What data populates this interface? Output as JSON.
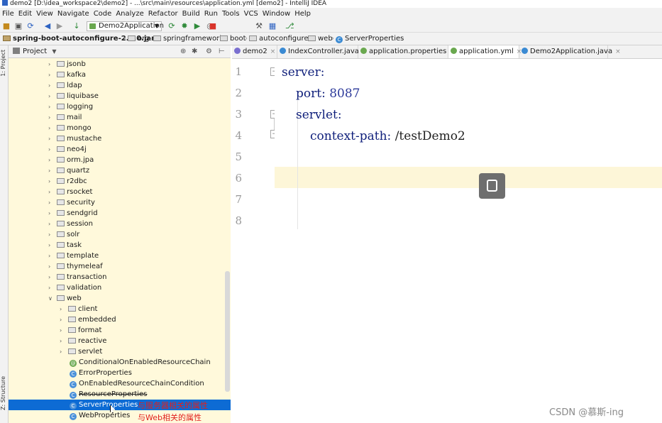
{
  "window": {
    "title": "demo2 [D:\\idea_workspace2\\demo2] - ...\\src\\main\\resources\\application.yml [demo2] - IntelliJ IDEA"
  },
  "menu": [
    {
      "label": "File"
    },
    {
      "label": "Edit"
    },
    {
      "label": "View"
    },
    {
      "label": "Navigate"
    },
    {
      "label": "Code"
    },
    {
      "label": "Analyze"
    },
    {
      "label": "Refactor"
    },
    {
      "label": "Build"
    },
    {
      "label": "Run"
    },
    {
      "label": "Tools"
    },
    {
      "label": "VCS"
    },
    {
      "label": "Window"
    },
    {
      "label": "Help"
    }
  ],
  "toolbar": {
    "run_config": "Demo2Application",
    "icons": [
      "open-icon",
      "save-icon",
      "sync-icon",
      "back-icon",
      "forward-icon",
      "build-icon",
      "run-icon",
      "debug-icon",
      "coverage-icon",
      "profile-icon",
      "stop-icon",
      "wrench-icon",
      "structure-icon",
      "vcs-icon"
    ]
  },
  "breadcrumb": [
    {
      "label": "spring-boot-autoconfigure-2.4.0.jar",
      "icon": "jar-icon"
    },
    {
      "label": "org",
      "icon": "folder-icon"
    },
    {
      "label": "springframework",
      "icon": "folder-icon"
    },
    {
      "label": "boot",
      "icon": "folder-icon"
    },
    {
      "label": "autoconfigure",
      "icon": "folder-icon"
    },
    {
      "label": "web",
      "icon": "folder-icon"
    },
    {
      "label": "ServerProperties",
      "icon": "class-icon"
    }
  ],
  "side_tabs": {
    "project": "1: Project",
    "structure": "Z: Structure"
  },
  "project_panel": {
    "title": "Project",
    "tree": [
      {
        "label": "jsonb",
        "type": "folder"
      },
      {
        "label": "kafka",
        "type": "folder"
      },
      {
        "label": "ldap",
        "type": "folder"
      },
      {
        "label": "liquibase",
        "type": "folder"
      },
      {
        "label": "logging",
        "type": "folder"
      },
      {
        "label": "mail",
        "type": "folder"
      },
      {
        "label": "mongo",
        "type": "folder"
      },
      {
        "label": "mustache",
        "type": "folder"
      },
      {
        "label": "neo4j",
        "type": "folder"
      },
      {
        "label": "orm.jpa",
        "type": "folder"
      },
      {
        "label": "quartz",
        "type": "folder"
      },
      {
        "label": "r2dbc",
        "type": "folder"
      },
      {
        "label": "rsocket",
        "type": "folder"
      },
      {
        "label": "security",
        "type": "folder"
      },
      {
        "label": "sendgrid",
        "type": "folder"
      },
      {
        "label": "session",
        "type": "folder"
      },
      {
        "label": "solr",
        "type": "folder"
      },
      {
        "label": "task",
        "type": "folder"
      },
      {
        "label": "template",
        "type": "folder"
      },
      {
        "label": "thymeleaf",
        "type": "folder"
      },
      {
        "label": "transaction",
        "type": "folder"
      },
      {
        "label": "validation",
        "type": "folder"
      },
      {
        "label": "web",
        "type": "folder",
        "expanded": true
      },
      {
        "label": "client",
        "type": "folder"
      },
      {
        "label": "embedded",
        "type": "folder"
      },
      {
        "label": "format",
        "type": "folder"
      },
      {
        "label": "reactive",
        "type": "folder"
      },
      {
        "label": "servlet",
        "type": "folder"
      },
      {
        "label": "ConditionalOnEnabledResourceChain",
        "type": "annotation"
      },
      {
        "label": "ErrorProperties",
        "type": "class"
      },
      {
        "label": "OnEnabledResourceChainCondition",
        "type": "class"
      },
      {
        "label": "ResourceProperties",
        "type": "class",
        "deprecated": true
      },
      {
        "label": "ServerProperties",
        "type": "class",
        "selected": true
      },
      {
        "label": "WebProperties",
        "type": "class"
      }
    ],
    "annotations": [
      "与服务器相关的属性",
      "与Web相关的属性"
    ]
  },
  "editor_tabs": [
    {
      "label": "demo2",
      "icon": "module-icon",
      "color": "#7a6fd0"
    },
    {
      "label": "IndexController.java",
      "icon": "class-icon",
      "color": "#3a8ad3"
    },
    {
      "label": "application.properties",
      "icon": "spring-icon",
      "color": "#6aa84f"
    },
    {
      "label": "application.yml",
      "icon": "spring-icon",
      "color": "#6aa84f",
      "active": true
    },
    {
      "label": "Demo2Application.java",
      "icon": "class-icon",
      "color": "#3a8ad3"
    }
  ],
  "editor": {
    "line_numbers": [
      "1",
      "2",
      "3",
      "4",
      "5",
      "6",
      "7",
      "8"
    ],
    "lines": [
      {
        "key": "server:",
        "value": ""
      },
      {
        "key": "port:",
        "value": "8087"
      },
      {
        "key": "servlet:",
        "value": ""
      },
      {
        "key": "context-path:",
        "value": "/testDemo2"
      }
    ]
  },
  "watermark": "CSDN @慕斯-ing",
  "colors": {
    "selection": "#0d6bd4",
    "tree_background": "#fff9db",
    "current_line": "#fdf6d8",
    "yaml_key": "#0e1e7a",
    "annotation_text": "#e0201d"
  }
}
